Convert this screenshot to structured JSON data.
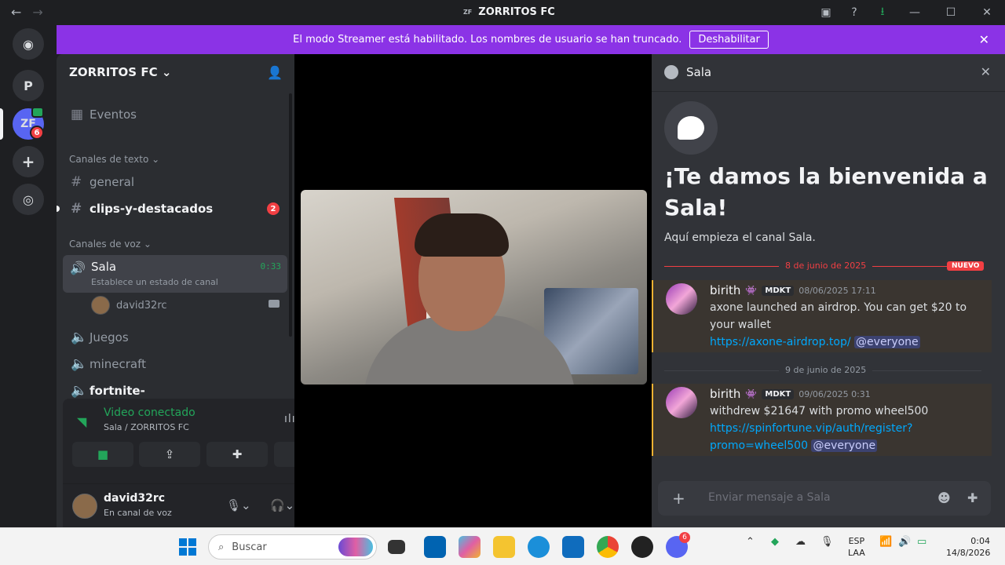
{
  "window": {
    "title": "ZORRITOS FC",
    "logo": "ZF",
    "back": "←",
    "forward": "→"
  },
  "guilds": {
    "home_icon": "discord-logo",
    "items": [
      {
        "label": "P"
      },
      {
        "label": "ZF",
        "badge": "6"
      }
    ],
    "add_icon": "plus-icon",
    "discover_icon": "compass-icon"
  },
  "banner": {
    "text": "El modo Streamer está habilitado. Los nombres de usuario se han truncado.",
    "button": "Deshabilitar"
  },
  "sidebar": {
    "server_name": "ZORRITOS FC",
    "events": "Eventos",
    "text_category": "Canales de texto",
    "text_channels": [
      {
        "name": "general"
      },
      {
        "name": "clips-y-destacados",
        "badge": "2"
      }
    ],
    "voice_category": "Canales de voz",
    "active_voice": {
      "name": "Sala",
      "status": "Establece un estado de canal",
      "time": "0:33",
      "user": "david32rc"
    },
    "voice_channels": [
      {
        "name": "Juegos"
      },
      {
        "name": "minecraft"
      },
      {
        "name": "fortnite-"
      }
    ]
  },
  "voice_panel": {
    "title": "Video conectado",
    "subtitle": "Sala / ZORRITOS FC"
  },
  "user_panel": {
    "name": "david32rc",
    "status": "En canal de voz"
  },
  "right_panel": {
    "channel": "Sala",
    "welcome_title": "¡Te damos la bienvenida a Sala!",
    "welcome_sub": "Aquí empieza el canal Sala.",
    "divider1": "8 de junio de 2025",
    "new_label": "NUEVO",
    "divider2": "9 de junio de 2025",
    "messages": [
      {
        "author": "birith",
        "tag": "MDKT",
        "time": "08/06/2025 17:11",
        "text": "axone launched an airdrop. You can get $20 to your wallet",
        "link": "https://axone-airdrop.top/",
        "mention": "@everyone"
      },
      {
        "author": "birith",
        "tag": "MDKT",
        "time": "09/06/2025 0:31",
        "text": "withdrew $21647 with promo wheel500",
        "link": "https://spinfortune.vip/auth/register?promo=wheel500",
        "mention": "@everyone"
      }
    ],
    "composer_placeholder": "Enviar mensaje a Sala"
  },
  "taskbar": {
    "search": "Buscar",
    "lang1": "ESP",
    "lang2": "LAA",
    "time": "0:04",
    "date": "14/8/2026",
    "discord_badge": "6"
  }
}
